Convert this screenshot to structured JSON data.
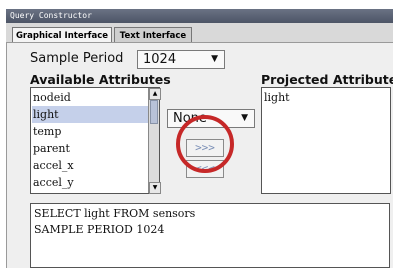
{
  "window": {
    "title": "Query Constructor"
  },
  "tabs": [
    {
      "label": "Graphical Interface",
      "active": true
    },
    {
      "label": "Text Interface",
      "active": false
    }
  ],
  "sample_period": {
    "label": "Sample Period",
    "value": "1024"
  },
  "available": {
    "heading": "Available Attributes",
    "items": [
      "nodeid",
      "light",
      "temp",
      "parent",
      "accel_x",
      "accel_y"
    ],
    "selected": "light"
  },
  "aggregate": {
    "value": "None"
  },
  "buttons": {
    "add": ">>>",
    "remove": "<<<"
  },
  "projected": {
    "heading": "Projected Attributes",
    "items": [
      "light"
    ]
  },
  "query": {
    "line1": "SELECT light FROM sensors",
    "line2": "SAMPLE PERIOD 1024"
  },
  "colors": {
    "highlight_ring": "#c62828",
    "selection": "#c5d0ea",
    "title_bar": "#5a6274"
  }
}
